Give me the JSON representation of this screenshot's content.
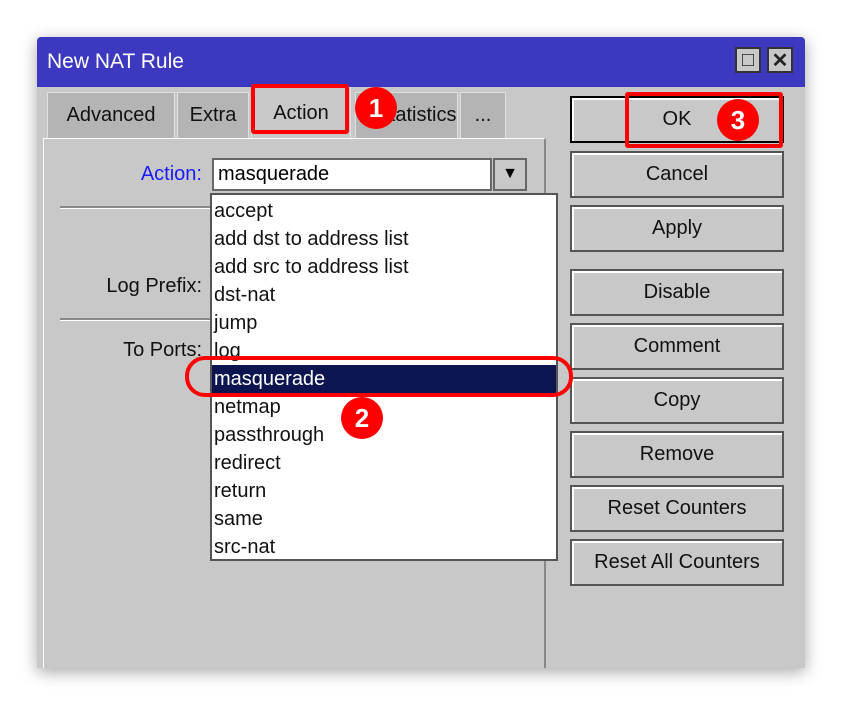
{
  "window": {
    "title": "New NAT Rule",
    "maximize_icon": "maximize-icon",
    "close_icon": "close-icon"
  },
  "tabs": [
    {
      "label": "Advanced"
    },
    {
      "label": "Extra"
    },
    {
      "label": "Action",
      "active": true
    },
    {
      "label": "Statistics"
    },
    {
      "label": "..."
    }
  ],
  "form": {
    "action_label": "Action:",
    "action_value": "masquerade",
    "log_prefix_label": "Log Prefix:",
    "to_ports_label": "To Ports:"
  },
  "dropdown": {
    "options": [
      "accept",
      "add dst to address list",
      "add src to address list",
      "dst-nat",
      "jump",
      "log",
      "masquerade",
      "netmap",
      "passthrough",
      "redirect",
      "return",
      "same",
      "src-nat"
    ],
    "selected": "masquerade"
  },
  "buttons": [
    "OK",
    "Cancel",
    "Apply",
    "Disable",
    "Comment",
    "Copy",
    "Remove",
    "Reset Counters",
    "Reset All Counters"
  ],
  "annotations": [
    "1",
    "2",
    "3"
  ],
  "colors": {
    "titlebar": "#3c38c0",
    "highlight": "#f00",
    "selected": "#0c1550",
    "label_active": "#1a1aff"
  }
}
